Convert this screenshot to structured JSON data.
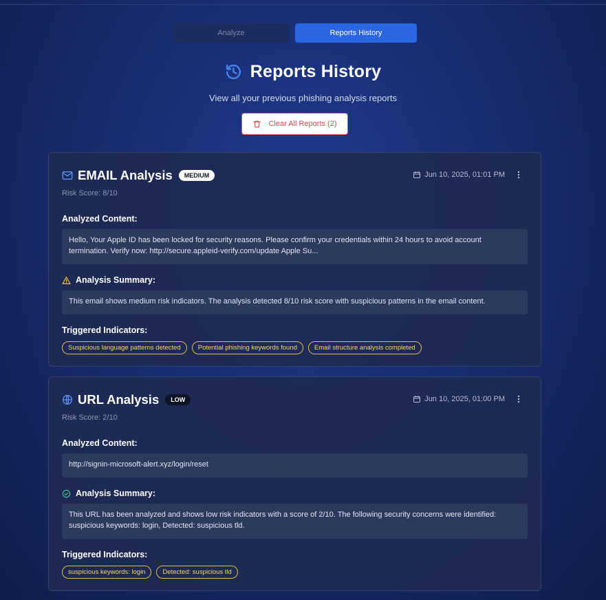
{
  "tabs": {
    "analyze": "Analyze",
    "reports": "Reports History"
  },
  "header": {
    "title": "Reports History",
    "subtitle": "View all your previous phishing analysis reports",
    "clear_button": "Clear All Reports (2)"
  },
  "labels": {
    "analyzed_content": "Analyzed Content:",
    "analysis_summary": "Analysis Summary:",
    "triggered_indicators": "Triggered Indicators:"
  },
  "reports": [
    {
      "icon": "mail-icon",
      "title": "EMAIL Analysis",
      "level": "MEDIUM",
      "risk": "Risk Score: 8/10",
      "date": "Jun 10, 2025, 01:01 PM",
      "content": "Hello, Your Apple ID has been locked for security reasons. Please confirm your credentials within 24 hours to avoid account termination. Verify now: http://secure.appleid-verify.com/update Apple Su...",
      "summary_icon": "warning-icon",
      "summary": "This email shows medium risk indicators. The analysis detected 8/10 risk score with suspicious patterns in the email content.",
      "indicators": [
        "Suspicious language patterns detected",
        "Potential phishing keywords found",
        "Email structure analysis completed"
      ]
    },
    {
      "icon": "globe-icon",
      "title": "URL Analysis",
      "level": "LOW",
      "risk": "Risk Score: 2/10",
      "date": "Jun 10, 2025, 01:00 PM",
      "content": "http://signin-microsoft-alert.xyz/login/reset",
      "summary_icon": "check-circle-icon",
      "summary": "This URL has been analyzed and shows low risk indicators with a score of 2/10. The following security concerns were identified: suspicious keywords: login, Detected: suspicious tld.",
      "indicators": [
        "suspicious keywords: login",
        "Detected: suspicious tld"
      ]
    }
  ],
  "colors": {
    "accent": "#2a66e3",
    "danger": "#e04848",
    "chip": "#e3c13a",
    "warning": "#f2c230",
    "success": "#34c38f"
  }
}
